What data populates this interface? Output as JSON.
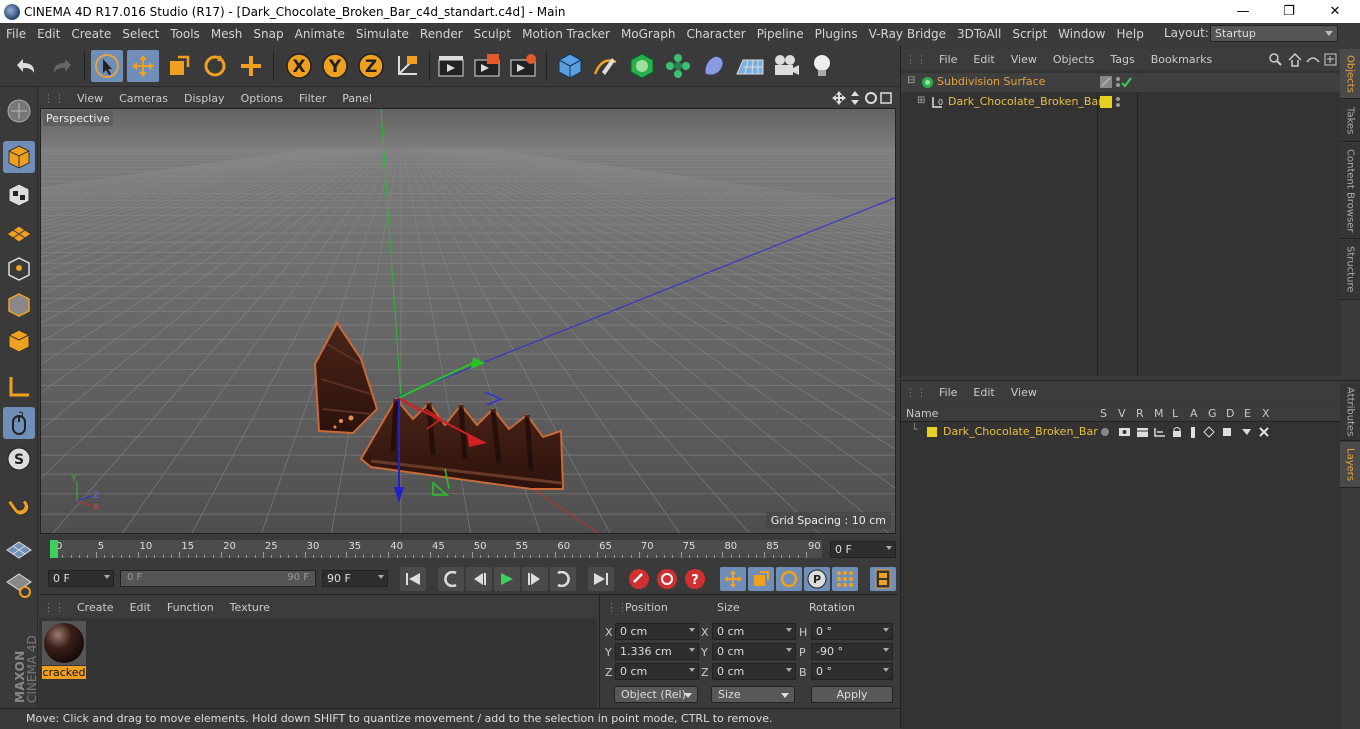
{
  "window": {
    "title": "CINEMA 4D R17.016 Studio (R17) - [Dark_Chocolate_Broken_Bar_c4d_standart.c4d] - Main",
    "minimize": "—",
    "maximize": "❐",
    "close": "✕"
  },
  "menu": {
    "items": [
      "File",
      "Edit",
      "Create",
      "Select",
      "Tools",
      "Mesh",
      "Snap",
      "Animate",
      "Simulate",
      "Render",
      "Sculpt",
      "Motion Tracker",
      "MoGraph",
      "Character",
      "Pipeline",
      "Plugins",
      "V-Ray Bridge",
      "3DToAll",
      "Script",
      "Window",
      "Help"
    ],
    "layout_label": "Layout:",
    "layout_value": "Startup"
  },
  "toolbar": {
    "axis_x": "X",
    "axis_y": "Y",
    "axis_z": "Z"
  },
  "viewport": {
    "menu": [
      "View",
      "Cameras",
      "Display",
      "Options",
      "Filter",
      "Panel"
    ],
    "camera_label": "Perspective",
    "grid_spacing": "Grid Spacing : 10 cm"
  },
  "objects_panel": {
    "menu": [
      "File",
      "Edit",
      "View",
      "Objects",
      "Tags",
      "Bookmarks"
    ],
    "items": [
      {
        "name": "Subdivision Surface",
        "color": "#e8a33a"
      },
      {
        "name": "Dark_Chocolate_Broken_Bar",
        "color": "#e8c040"
      }
    ]
  },
  "layers_panel": {
    "menu": [
      "File",
      "Edit",
      "View"
    ],
    "name_header": "Name",
    "columns": [
      "S",
      "V",
      "R",
      "M",
      "L",
      "A",
      "G",
      "D",
      "E",
      "X"
    ],
    "layer_name": "Dark_Chocolate_Broken_Bar"
  },
  "right_tabs": {
    "top": [
      "Objects",
      "Takes",
      "Content Browser",
      "Structure"
    ],
    "bottom": [
      "Attributes",
      "Layers"
    ]
  },
  "timeline": {
    "ticks": [
      "0",
      "5",
      "10",
      "15",
      "20",
      "25",
      "30",
      "35",
      "40",
      "45",
      "50",
      "55",
      "60",
      "65",
      "70",
      "75",
      "80",
      "85",
      "90"
    ],
    "current_frame": "0 F",
    "start_frame": "0 F",
    "range_start": "0 F",
    "range_end": "90 F",
    "end_frame": "90 F"
  },
  "material_panel": {
    "menu": [
      "Create",
      "Edit",
      "Function",
      "Texture"
    ],
    "material_name": "cracked"
  },
  "coords": {
    "headers": {
      "position": "Position",
      "size": "Size",
      "rotation": "Rotation"
    },
    "rows": [
      {
        "axis": "X",
        "pos": "0 cm",
        "size_axis": "X",
        "size": "0 cm",
        "rot_axis": "H",
        "rot": "0 °"
      },
      {
        "axis": "Y",
        "pos": "1.336 cm",
        "size_axis": "Y",
        "size": "0 cm",
        "rot_axis": "P",
        "rot": "-90 °"
      },
      {
        "axis": "Z",
        "pos": "0 cm",
        "size_axis": "Z",
        "size": "0 cm",
        "rot_axis": "B",
        "rot": "0 °"
      }
    ],
    "mode": "Object (Rel)",
    "size_mode": "Size",
    "apply": "Apply"
  },
  "branding": {
    "brand": "MAXON",
    "product": "CINEMA 4D"
  },
  "status": {
    "text": "Move: Click and drag to move elements. Hold down SHIFT to quantize movement / add to the selection in point mode, CTRL to remove."
  }
}
